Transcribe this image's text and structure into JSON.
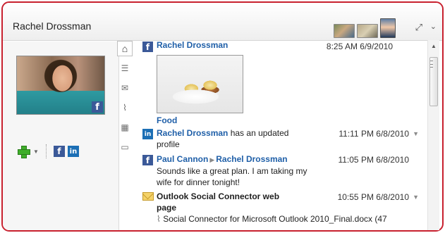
{
  "header": {
    "contact_name": "Rachel Drossman",
    "expand_icon": "expand-arrows-icon",
    "menu_icon": "chevron-down-icon"
  },
  "tabs": [
    {
      "icon": "home-icon",
      "glyph": "⌂",
      "active": true
    },
    {
      "icon": "activity-list-icon",
      "glyph": "☰"
    },
    {
      "icon": "mail-icon",
      "glyph": "✉"
    },
    {
      "icon": "attachment-icon",
      "glyph": "⌇"
    },
    {
      "icon": "calendar-icon",
      "glyph": "▦"
    },
    {
      "icon": "status-update-icon",
      "glyph": "▭"
    }
  ],
  "feed": [
    {
      "source": "facebook",
      "name": "Rachel Drossman",
      "time": "8:25 AM 6/9/2010",
      "caption": "Food"
    },
    {
      "source": "linkedin",
      "name": "Rachel Drossman",
      "text": " has an updated profile",
      "time": "11:11 PM 6/8/2010"
    },
    {
      "source": "facebook",
      "from": "Paul Cannon",
      "to": "Rachel Drossman",
      "text": "Sounds like a great plan. I am taking my wife for dinner tonight!",
      "time": "11:05 PM 6/8/2010"
    },
    {
      "source": "email",
      "subject": "Outlook Social Connector web page",
      "attachment": "Social Connector for Microsoft Outlook 2010_Final.docx (47",
      "time": "10:55 PM 6/8/2010"
    }
  ],
  "colors": {
    "frame": "#c8202e",
    "link": "#1f5fa8",
    "facebook": "#3b5998",
    "linkedin": "#1c6fb5"
  }
}
